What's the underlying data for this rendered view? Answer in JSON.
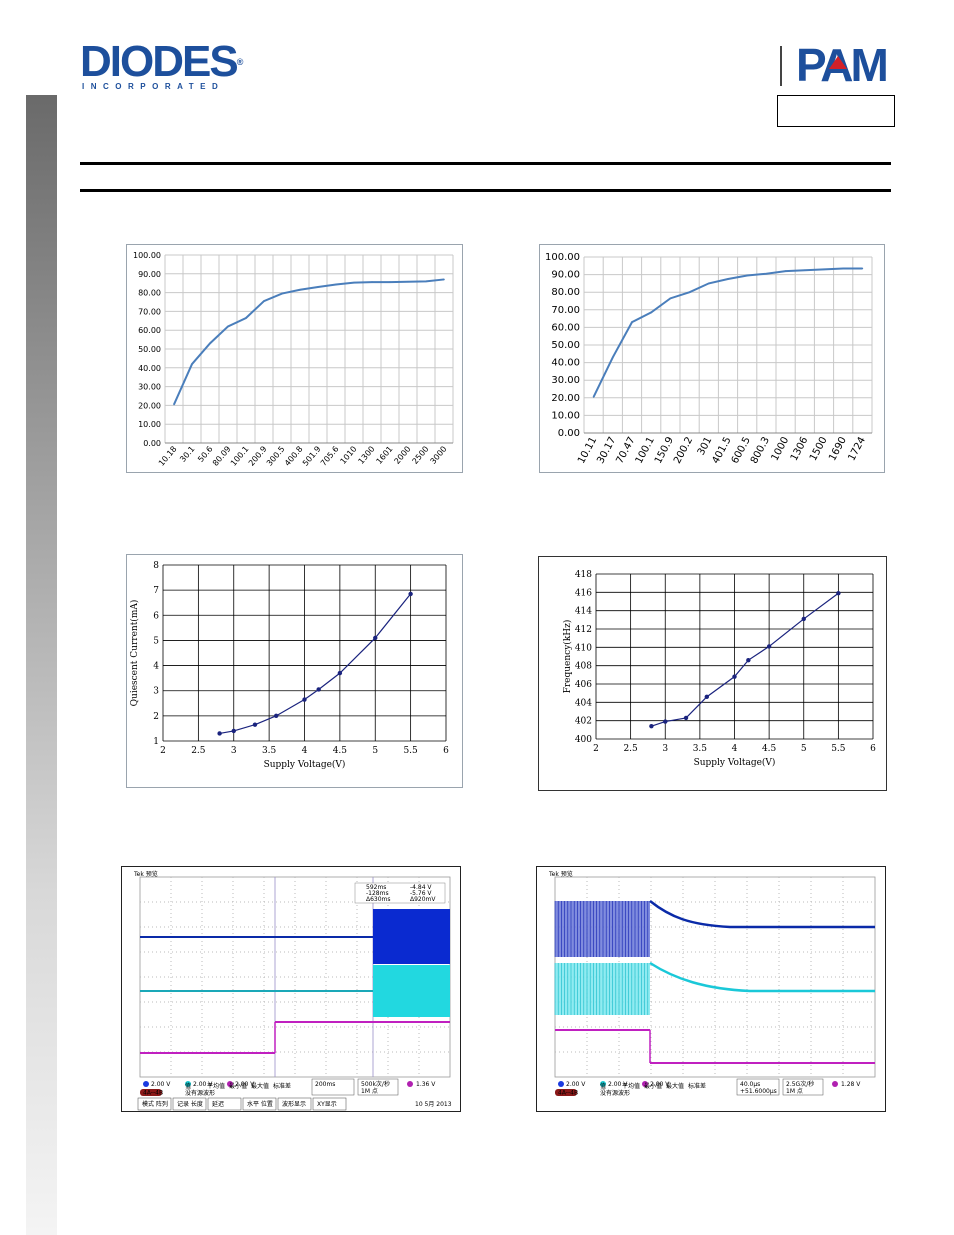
{
  "header": {
    "brand_left": "DIODES",
    "brand_left_sub": "INCORPORATED",
    "brand_left_mark": "®",
    "brand_right": "PAM",
    "brand_right_accent": "#d22028",
    "brand_color": "#1d4f9c"
  },
  "chart_data": [
    {
      "type": "line",
      "categories": [
        "10.18",
        "30.1",
        "50.6",
        "80.09",
        "100.1",
        "200.9",
        "300.5",
        "400.8",
        "501.9",
        "705.6",
        "1010",
        "1300",
        "1601",
        "2000",
        "2500",
        "3000"
      ],
      "series": [
        {
          "values": [
            20.5,
            42,
            53,
            62,
            66.5,
            75.5,
            79.5,
            81.5,
            83,
            84.3,
            85.3,
            85.6,
            85.6,
            85.8,
            86,
            87
          ]
        }
      ],
      "ylim": [
        0,
        100
      ],
      "yticks": [
        "0.00",
        "10.00",
        "20.00",
        "30.00",
        "40.00",
        "50.00",
        "60.00",
        "70.00",
        "80.00",
        "90.00",
        "100.00"
      ],
      "color": "#4a7ebb",
      "grid": true
    },
    {
      "type": "line",
      "categories": [
        "10.11",
        "30.17",
        "70.47",
        "100.1",
        "150.9",
        "200.2",
        "301",
        "401.5",
        "600.5",
        "800.3",
        "1000",
        "1306",
        "1500",
        "1690",
        "1724"
      ],
      "series": [
        {
          "values": [
            20.5,
            43,
            63,
            68.5,
            76.5,
            80,
            85,
            87.5,
            89.5,
            90.5,
            92,
            92.5,
            93,
            93.5,
            93.5
          ]
        }
      ],
      "ylim": [
        0,
        100
      ],
      "yticks": [
        "0.00",
        "10.00",
        "20.00",
        "30.00",
        "40.00",
        "50.00",
        "60.00",
        "70.00",
        "80.00",
        "90.00",
        "100.00"
      ],
      "color": "#4a7ebb",
      "grid": true
    },
    {
      "type": "line",
      "x": [
        2.8,
        3.0,
        3.3,
        3.6,
        4.0,
        4.2,
        4.5,
        5.0,
        5.5
      ],
      "series": [
        {
          "values": [
            1.3,
            1.4,
            1.65,
            2.0,
            2.65,
            3.05,
            3.7,
            5.1,
            6.85
          ]
        }
      ],
      "xlim": [
        2,
        6
      ],
      "ylim": [
        1,
        8
      ],
      "xticks": [
        "2",
        "2.5",
        "3",
        "3.5",
        "4",
        "4.5",
        "5",
        "5.5",
        "6"
      ],
      "yticks": [
        "1",
        "2",
        "3",
        "4",
        "5",
        "6",
        "7",
        "8"
      ],
      "xlabel": "Supply Voltage(V)",
      "ylabel": "Quiescent Current(mA)",
      "color": "#1a237e",
      "grid": true
    },
    {
      "type": "line",
      "x": [
        2.8,
        3.0,
        3.3,
        3.6,
        4.0,
        4.2,
        4.5,
        5.0,
        5.5
      ],
      "series": [
        {
          "values": [
            401.4,
            401.9,
            402.3,
            404.6,
            406.8,
            408.6,
            410.1,
            413.1,
            415.9
          ]
        }
      ],
      "xlim": [
        2,
        6
      ],
      "ylim": [
        400,
        418
      ],
      "xticks": [
        "2",
        "2.5",
        "3",
        "3.5",
        "4",
        "4.5",
        "5",
        "5.5",
        "6"
      ],
      "yticks": [
        "400",
        "402",
        "404",
        "406",
        "408",
        "410",
        "412",
        "414",
        "416",
        "418"
      ],
      "xlabel": "Supply Voltage(V)",
      "ylabel": "Frequency(kHz)",
      "color": "#1a237e",
      "grid": true
    }
  ],
  "scopes": {
    "left": {
      "brand": "Tek",
      "mode": "预览",
      "cursor_readout": [
        "592ms",
        "-128ms",
        "Δ630ms",
        "-4.84 V",
        "-5.76 V",
        "Δ920mV"
      ],
      "ch1": "2.00 V",
      "ch2": "2.00 V",
      "ch3": "2.00 V",
      "ref": "4A--4B",
      "timebase": "200ms",
      "sample": "500k次/秒",
      "points": "1M 点",
      "trigger": "1.36 V",
      "menu": [
        "模式 阵列",
        "记录 长度",
        "延迟",
        "水平 位置",
        "波形显示",
        "XY显示"
      ],
      "stat_labels": [
        "值",
        "平均值",
        "最小值",
        "最大值",
        "标准差"
      ],
      "note": "没有源波形",
      "datetime": "10 5月 2013"
    },
    "right": {
      "brand": "Tek",
      "mode": "预览",
      "ch1": "2.00 V",
      "ch2": "2.00 V",
      "ch3": "2.00 V",
      "ref": "4A--4B",
      "timebase": "40.0μs",
      "sample": "2.5G次/秒",
      "points": "1M 点",
      "trigger": "1.28 V",
      "offset": "+51.6000μs",
      "stat_labels": [
        "值",
        "平均值",
        "最小值",
        "最大值",
        "标准差"
      ],
      "note": "没有源波形"
    }
  }
}
